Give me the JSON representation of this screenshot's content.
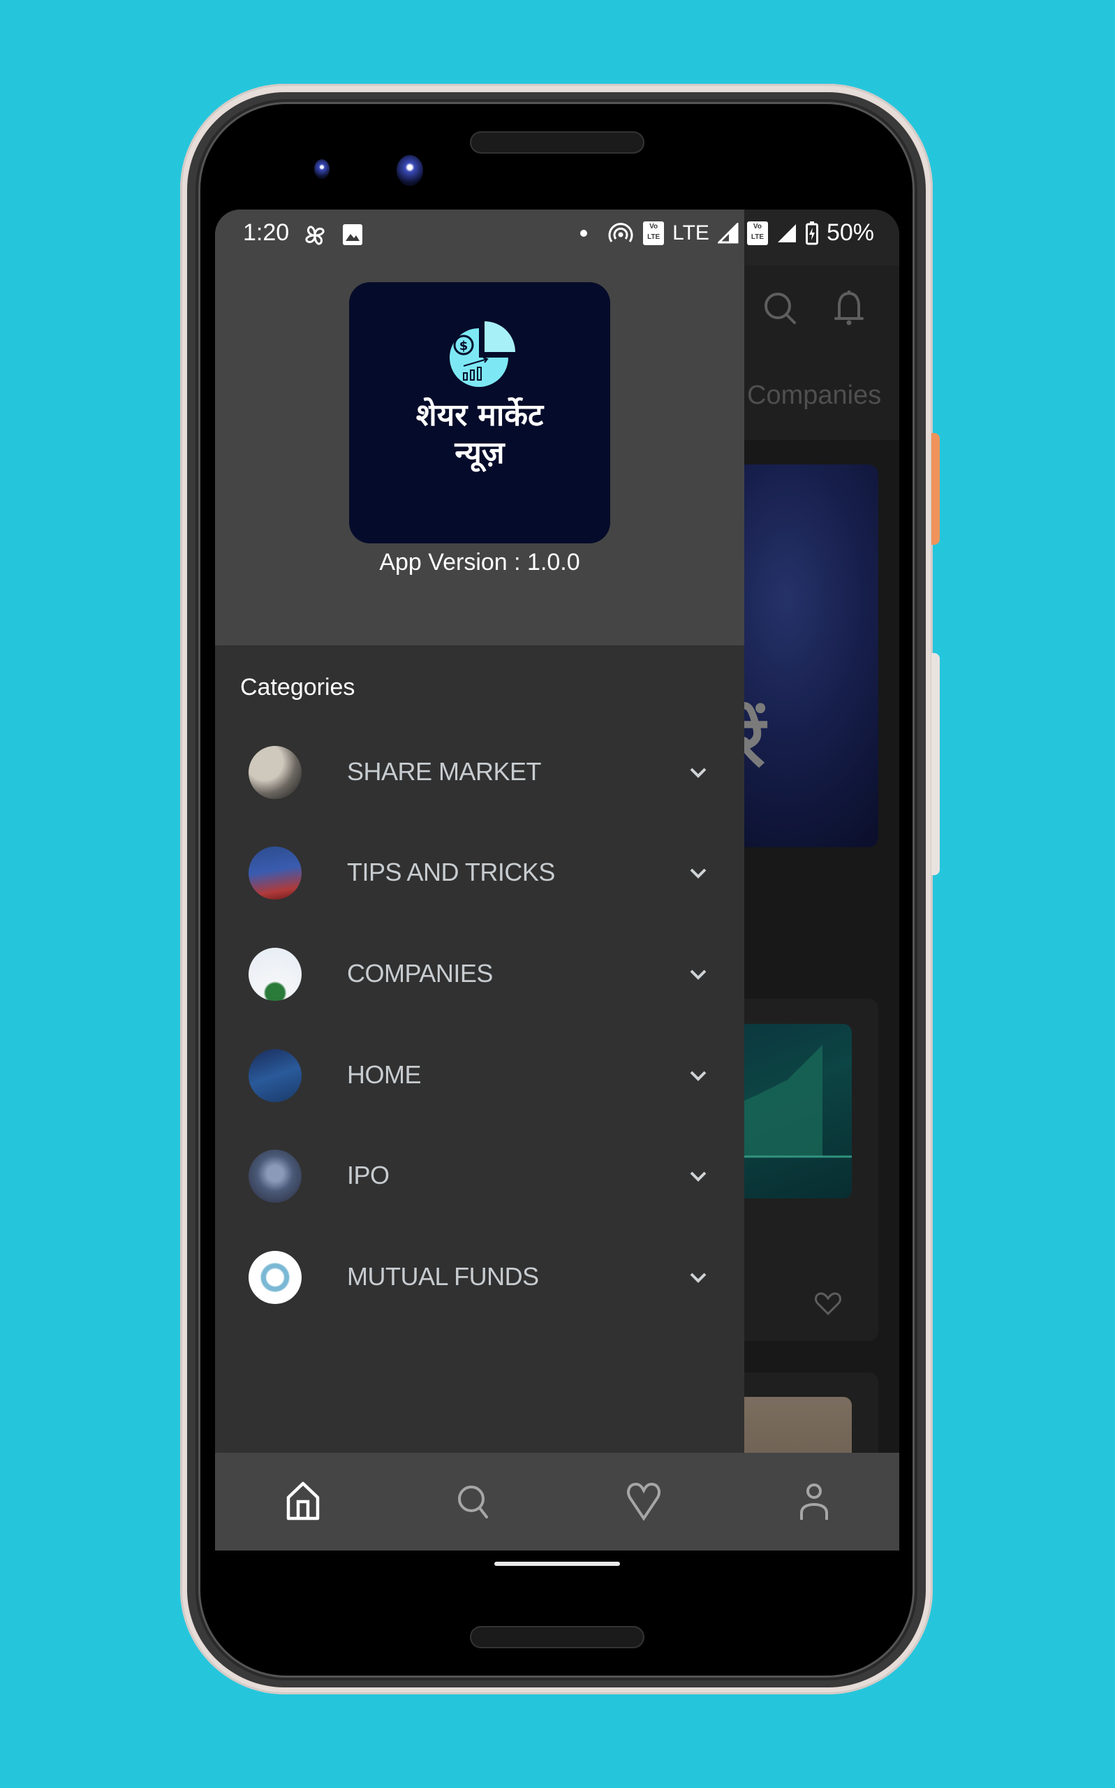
{
  "status_bar": {
    "time": "1:20",
    "left_icons": [
      "fan-icon",
      "image-icon"
    ],
    "right_icons": [
      "dot-icon",
      "hotspot-icon",
      "volte-icon",
      "signal-icon",
      "volte-icon",
      "signal-icon",
      "battery-charging-icon"
    ],
    "network_label": "LTE",
    "volte_line1": "Vo",
    "volte_line2": "LTE",
    "battery": "50%"
  },
  "drawer": {
    "logo": {
      "title_line1": "शेयर मार्केट",
      "title_line2": "न्यूज़"
    },
    "app_version": "App Version : 1.0.0",
    "categories_title": "Categories",
    "categories": [
      {
        "label": "SHARE MARKET",
        "thumb": "laptop-phone-thumb"
      },
      {
        "label": "TIPS AND TRICKS",
        "thumb": "tips-tricks-thumb"
      },
      {
        "label": "COMPANIES",
        "thumb": "tata-companies-thumb"
      },
      {
        "label": "HOME",
        "thumb": "stock-chart-thumb"
      },
      {
        "label": "IPO",
        "thumb": "ipo-thumb"
      },
      {
        "label": "MUTUAL FUNDS",
        "thumb": "mutual-funds-thumb"
      }
    ]
  },
  "background_app": {
    "header_icons": [
      "search-icon",
      "bell-icon"
    ],
    "visible_tab": "Companies",
    "banner_text": "बरें"
  },
  "bottom_nav": {
    "items": [
      {
        "name": "home",
        "active": true
      },
      {
        "name": "search",
        "active": false
      },
      {
        "name": "favorites",
        "active": false
      },
      {
        "name": "profile",
        "active": false
      }
    ]
  },
  "colors": {
    "background": "#25c6dc",
    "drawer_header": "#454545",
    "drawer_body": "#313131",
    "logo_bg": "#050b2a",
    "logo_accent": "#7de8f4",
    "category_text": "#c7ccd0"
  }
}
